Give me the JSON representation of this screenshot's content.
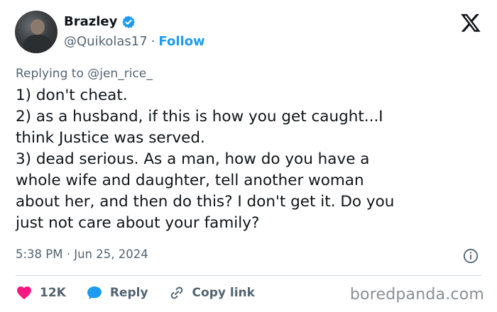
{
  "author": {
    "display_name": "Brazley",
    "handle": "@Quikolas17",
    "separator": "·",
    "follow_label": "Follow"
  },
  "reply": {
    "label": "Replying to",
    "target": "@jen_rice_"
  },
  "tweet": {
    "lines": [
      "1) don't cheat.",
      "2) as a husband, if this is how you get caught...I",
      "think Justice was served.",
      "3) dead serious. As a man, how do you have a",
      "whole wife and daughter, tell another woman",
      "about her, and then do this? I don't get it. Do you",
      "just not care about your family?"
    ],
    "timestamp": "5:38 PM · Jun 25, 2024"
  },
  "actions": {
    "like_count": "12K",
    "reply_label": "Reply",
    "copy_link_label": "Copy link"
  },
  "watermark": "boredpanda.com",
  "icons": {
    "verified": "verified-badge-icon",
    "logo": "x-logo-icon",
    "info": "info-icon",
    "like": "heart-icon",
    "reply": "speech-bubble-icon",
    "copy": "link-icon"
  },
  "colors": {
    "accent": "#1d9bf0",
    "like": "#f91880",
    "muted": "#536471",
    "text": "#0f1419"
  }
}
